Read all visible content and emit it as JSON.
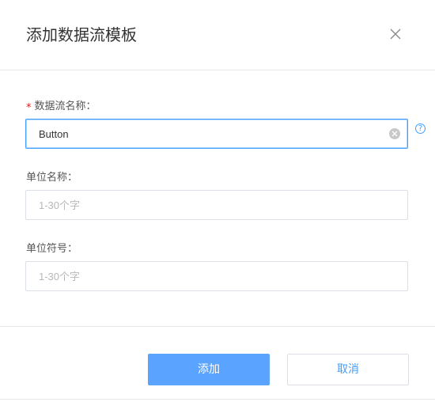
{
  "dialog": {
    "title": "添加数据流模板"
  },
  "form": {
    "stream_name": {
      "required_mark": "*",
      "label": "数据流名称：",
      "value": "Button",
      "help": "?"
    },
    "unit_name": {
      "label": "单位名称：",
      "placeholder": "1-30个字"
    },
    "unit_symbol": {
      "label": "单位符号：",
      "placeholder": "1-30个字"
    }
  },
  "footer": {
    "add_label": "添加",
    "cancel_label": "取消"
  },
  "colors": {
    "accent": "#409eff",
    "primary_button": "#5aa3ff",
    "required": "#e02020"
  },
  "icons": {
    "close": "close-icon",
    "clear": "clear-input-icon",
    "help": "help-icon"
  }
}
